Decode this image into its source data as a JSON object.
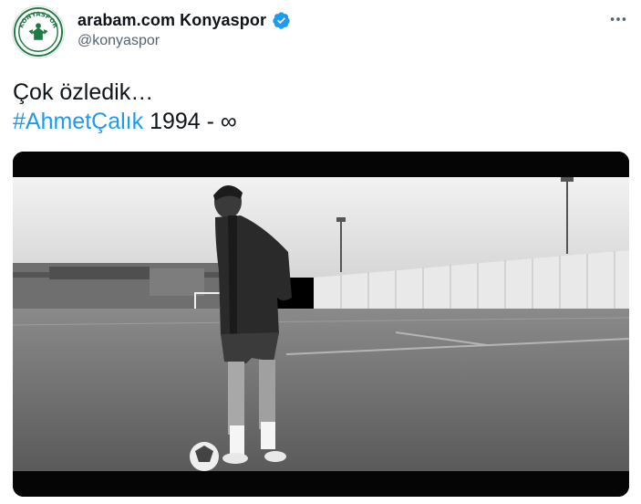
{
  "author": {
    "display_name": "arabam.com Konyaspor",
    "handle": "@konyaspor",
    "avatar_text": "KONYASPOR",
    "verified_icon": "verified-badge-icon",
    "verified_color": "#1d9bf0"
  },
  "actions": {
    "more_icon": "more-horizontal-icon"
  },
  "tweet": {
    "line1": "Çok özledik…",
    "hashtag": "#AhmetÇalık",
    "line2_suffix": " 1994 - ∞",
    "hashtag_color": "#1d9bf0"
  },
  "media": {
    "type": "photo",
    "style": "black-and-white"
  }
}
